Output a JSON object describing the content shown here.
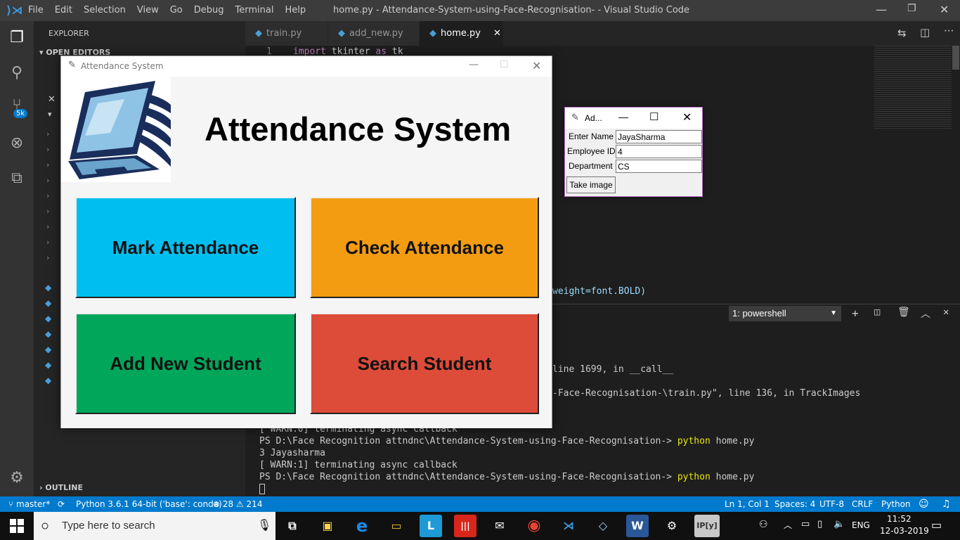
{
  "vscode": {
    "menu": [
      "File",
      "Edit",
      "Selection",
      "View",
      "Go",
      "Debug",
      "Terminal",
      "Help"
    ],
    "window_title": "home.py - Attendance-System-using-Face-Recognisation- - Visual Studio Code",
    "explorer_title": "EXPLORER",
    "open_editors_label": "OPEN EDITORS",
    "outline_label": "OUTLINE",
    "source_control_badge": "5k",
    "tabs": [
      {
        "label": "train.py",
        "active": false
      },
      {
        "label": "add_new.py",
        "active": false
      },
      {
        "label": "home.py",
        "active": true
      }
    ],
    "editor": {
      "line_number": "1",
      "line1_keyword": "import",
      "line1_rest": " tkinter ",
      "line1_as": "as",
      "line1_alias": " tk",
      "visible_code_fragment": "weight=font.BOLD)"
    },
    "terminal": {
      "selector": "1: powershell",
      "lines": [
        "line 1699, in __call__",
        "-Face-Recognisation-\\train.py\", line 136, in TrackImages",
        "[ WARN:0] terminating async callback",
        "PS D:\\Face Recognition attndnc\\Attendance-System-using-Face-Recognisation-> python home.py",
        "3 Jayasharma",
        "[ WARN:1] terminating async callback",
        "PS D:\\Face Recognition attndnc\\Attendance-System-using-Face-Recognisation-> python home.py"
      ],
      "prompt_prefix": "PS D:\\Face Recognition attndnc\\Attendance-System-using-Face-Recognisation-> ",
      "cmd": "python",
      "cmd_arg": " home.py"
    },
    "status": {
      "branch": "master*",
      "interpreter": "Python 3.6.1 64-bit ('base': conda)",
      "errors": "28",
      "warnings": "214",
      "position": "Ln 1, Col 1",
      "spaces": "Spaces: 4",
      "encoding": "UTF-8",
      "eol": "CRLF",
      "language": "Python"
    }
  },
  "attendance_window": {
    "title": "Attendance System",
    "heading": "Attendance System",
    "buttons": {
      "mark": "Mark Attendance",
      "check": "Check Attendance",
      "add": "Add New Student",
      "search": "Search Student"
    },
    "colors": {
      "mark": "#00bff0",
      "check": "#f39c12",
      "add": "#00a65a",
      "search": "#dd4b39"
    }
  },
  "add_window": {
    "title": "Ad...",
    "fields": {
      "name_label": "Enter Name",
      "name_value": "JayaSharma",
      "id_label": "Employee ID",
      "id_value": "4",
      "dept_label": "Department",
      "dept_value": "CS"
    },
    "take_image": "Take image"
  },
  "taskbar": {
    "search_placeholder": "Type here to search",
    "language": "ENG",
    "time": "11:52",
    "date": "12-03-2019"
  }
}
